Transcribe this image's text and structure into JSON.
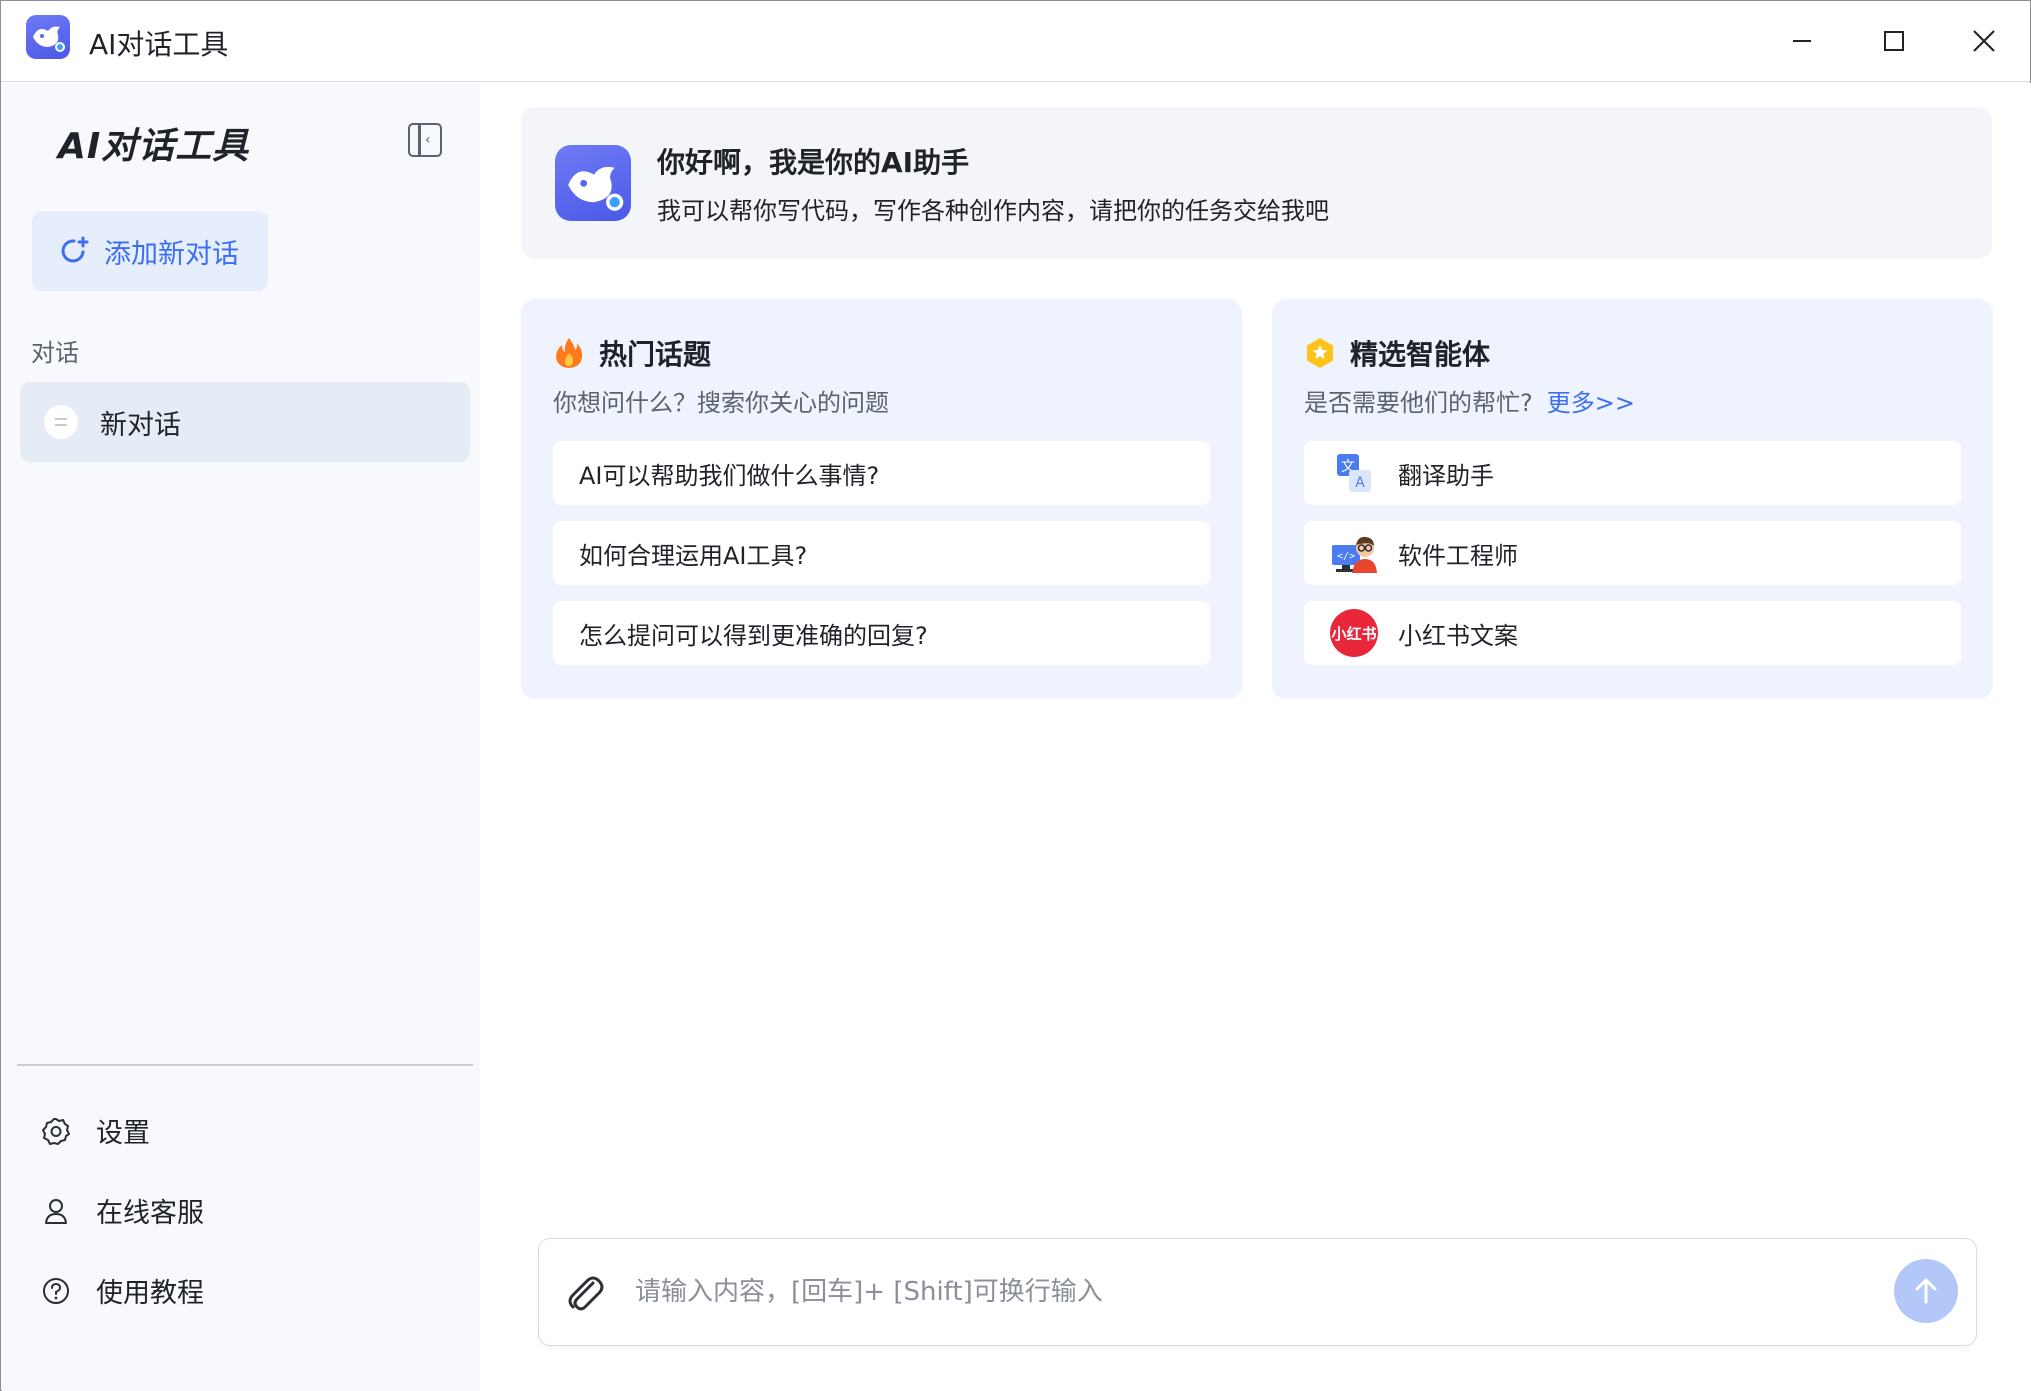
{
  "titlebar": {
    "title": "AI对话工具",
    "icons": [
      "app-logo-icon",
      "minimize-icon",
      "maximize-icon",
      "close-icon"
    ]
  },
  "sidebar": {
    "title": "AI对话工具",
    "collapse_icon": "sidebar-collapse-icon",
    "new_chat_label": "添加新对话",
    "section_label": "对话",
    "conversations": [
      {
        "label": "新对话",
        "icon": "chat-bubble-icon"
      }
    ],
    "menu": [
      {
        "label": "设置",
        "icon": "gear-icon"
      },
      {
        "label": "在线客服",
        "icon": "user-icon"
      },
      {
        "label": "使用教程",
        "icon": "help-circle-icon"
      }
    ]
  },
  "welcome": {
    "title": "你好啊，我是你的AI助手",
    "subtitle": "我可以帮你写代码，写作各种创作内容，请把你的任务交给我吧"
  },
  "hot_topics": {
    "title": "热门话题",
    "icon": "fire-icon",
    "subtitle": "你想问什么？搜索你关心的问题",
    "items": [
      "AI可以帮助我们做什么事情?",
      "如何合理运用AI工具?",
      "怎么提问可以得到更准确的回复?"
    ]
  },
  "agents": {
    "title": "精选智能体",
    "icon": "star-badge-icon",
    "subtitle": "是否需要他们的帮忙?",
    "more_label": "更多>>",
    "items": [
      {
        "label": "翻译助手",
        "icon": "translate-icon"
      },
      {
        "label": "软件工程师",
        "icon": "engineer-avatar-icon"
      },
      {
        "label": "小红书文案",
        "icon": "xiaohongshu-logo-icon",
        "logo_text": "小红书"
      }
    ]
  },
  "input": {
    "placeholder": "请输入内容，[回车]+ [Shift]可换行输入",
    "value": "",
    "attach_icon": "paperclip-icon",
    "send_icon": "send-arrow-icon"
  },
  "colors": {
    "accent": "#3c6ff0",
    "brand": "#5a67ef",
    "sidebar_bg": "#f7f9fc",
    "panel_bg": "#eef3fd",
    "send_disabled": "#b3c8f8"
  }
}
